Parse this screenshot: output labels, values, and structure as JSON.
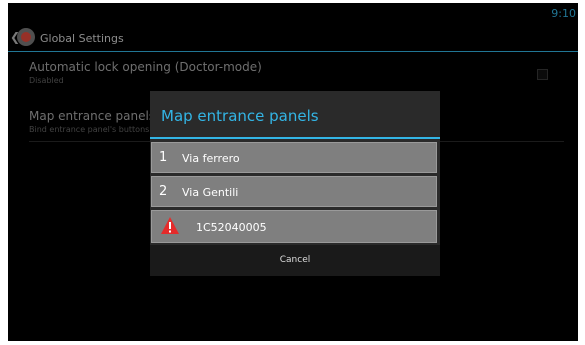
{
  "status_bar": {
    "time": "9:10"
  },
  "action_bar": {
    "up_icon": "chevron-left-icon",
    "app_icon": "settings-app-icon",
    "title": "Global Settings"
  },
  "preferences": [
    {
      "title": "Automatic lock opening (Doctor-mode)",
      "summary": "Disabled"
    },
    {
      "title": "Map entrance panels",
      "summary": "Bind entrance panel's buttons"
    }
  ],
  "dialog": {
    "title": "Map entrance panels",
    "items": [
      {
        "number": "1",
        "label": "Via ferrero"
      },
      {
        "number": "2",
        "label": "Via Gentili"
      },
      {
        "icon": "warning-icon",
        "label": "1C52040005"
      }
    ],
    "cancel_label": "Cancel"
  },
  "colors": {
    "accent": "#33b5e5",
    "warning": "#e52b2b",
    "background": "#000000",
    "dialog_background": "#2a2a2a"
  }
}
